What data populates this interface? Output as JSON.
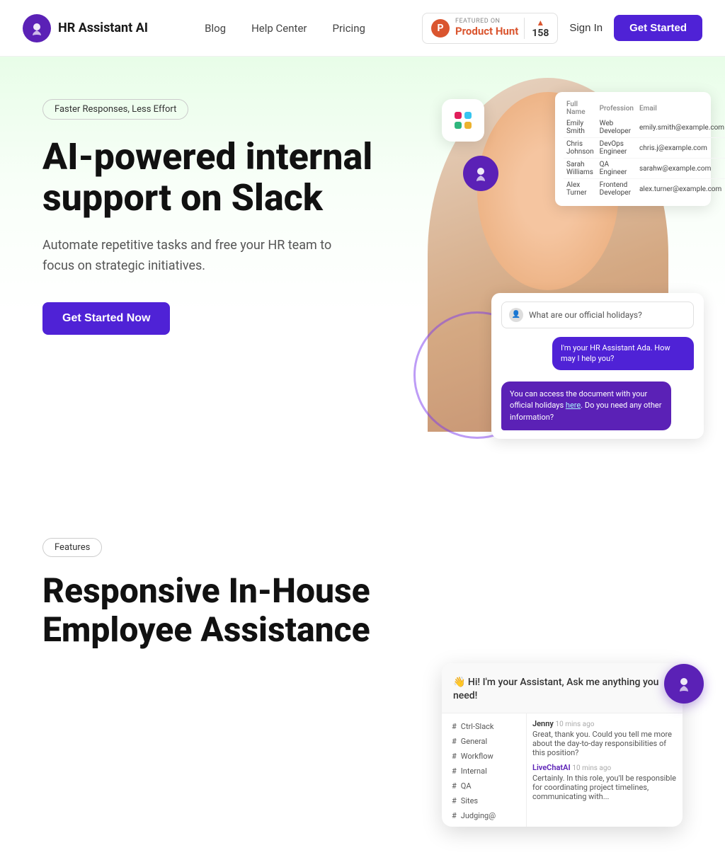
{
  "nav": {
    "logo_text": "HR Assistant AI",
    "links": [
      "Blog",
      "Help Center",
      "Pricing"
    ],
    "product_hunt": {
      "featured_label": "FEATURED ON",
      "name": "Product Hunt",
      "count": "158"
    },
    "sign_in": "Sign In",
    "get_started": "Get Started"
  },
  "hero": {
    "badge": "Faster Responses, Less Effort",
    "title": "AI-powered internal support on Slack",
    "subtitle": "Automate repetitive tasks and free your HR team to focus on strategic initiatives.",
    "cta": "Get Started Now",
    "table": {
      "headers": [
        "Full Name",
        "Profession",
        "Email"
      ],
      "rows": [
        [
          "Emily Smith",
          "Web Developer",
          "emily.smith@example.com"
        ],
        [
          "Chris Johnson",
          "DevOps Engineer",
          "chris.j@example.com"
        ],
        [
          "Sarah Williams",
          "QA Engineer",
          "sarahw@example.com"
        ],
        [
          "Alex Turner",
          "Frontend Developer",
          "alex.turner@example.com"
        ]
      ]
    },
    "chat": {
      "question": "What are our official holidays?",
      "bubble1": "I'm your HR Assistant Ada. How may I help you?",
      "bubble2": "You can access the document with your official holidays here. Do you need any other information?"
    }
  },
  "section2": {
    "badge": "Features",
    "title": "Responsive In-House Employee Assistance"
  },
  "chat_panel": {
    "header": "👋 Hi! I'm your Assistant, Ask me anything you need!",
    "channels": [
      {
        "name": "Ctrl-Slack",
        "active": false
      },
      {
        "name": "General",
        "active": false
      },
      {
        "name": "Workflow",
        "active": false
      },
      {
        "name": "Internal",
        "active": false
      },
      {
        "name": "QA",
        "active": false
      },
      {
        "name": "Sites",
        "active": false
      },
      {
        "name": "Judging@",
        "active": false
      }
    ],
    "messages": [
      {
        "sender": "Jenny",
        "time": "10 mins ago",
        "text": "Great, thank you. Could you tell me more about the day-to-day responsibilities of this position?"
      },
      {
        "sender": "LiveChatAI",
        "time": "10 mins ago",
        "text": "Certainly. In this role, you'll be responsible for coordinating project timelines, communicating with..."
      }
    ]
  }
}
